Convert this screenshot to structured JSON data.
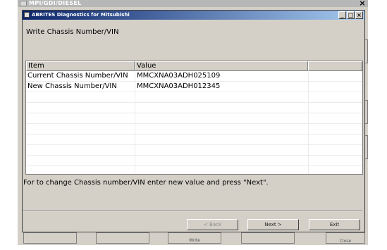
{
  "outer_window": {
    "title": "MPI/GDI/DIESEL",
    "bottom_buttons": [
      "Write",
      "Close"
    ]
  },
  "dialog": {
    "title": "ABRITES Diagnostics for Mitsubishi",
    "controls": {
      "minimize": "_",
      "maximize": "□",
      "close": "×"
    },
    "heading": "Write Chassis Number/VIN",
    "table": {
      "columns": [
        "Item",
        "Value"
      ],
      "rows": [
        {
          "item": "Current Chassis Number/VIN",
          "value": "MMCXNA03ADH025109"
        },
        {
          "item": "New Chassis Number/VIN",
          "value": "MMCXNA03ADH012345"
        }
      ]
    },
    "instruction": "For to change Chassis number/VIN enter new value and press \"Next\".",
    "buttons": {
      "back": "< Back",
      "next": "Next >",
      "exit": "Exit"
    }
  }
}
